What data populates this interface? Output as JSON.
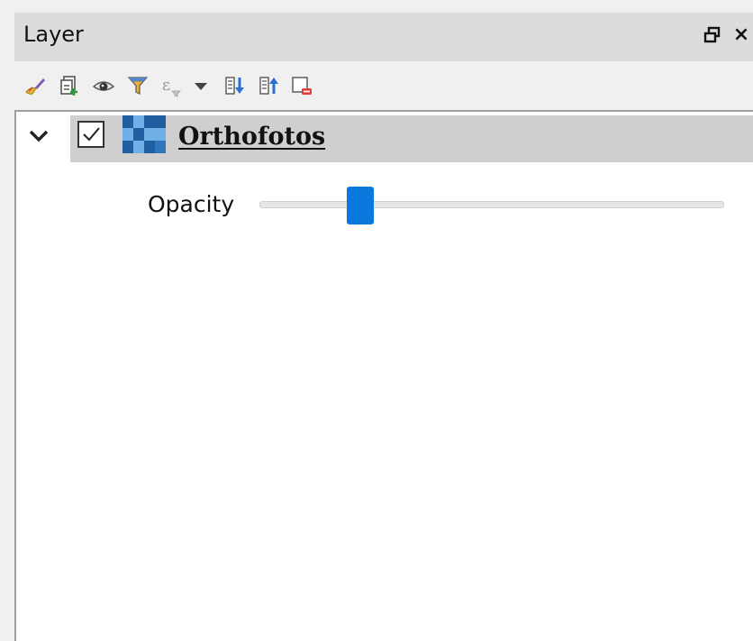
{
  "panel": {
    "title": "Layer",
    "close_glyph": "×"
  },
  "toolbar": {
    "tools": [
      {
        "name": "style-manager-icon"
      },
      {
        "name": "add-group-icon"
      },
      {
        "name": "visibility-eye-icon"
      },
      {
        "name": "filter-legend-icon"
      },
      {
        "name": "filter-expression-icon"
      },
      {
        "name": "dropdown-arrow-icon"
      },
      {
        "name": "expand-all-icon"
      },
      {
        "name": "collapse-all-icon"
      },
      {
        "name": "remove-layer-icon"
      }
    ]
  },
  "tree": {
    "layer": {
      "name": "Orthofotos",
      "checked": true,
      "expanded": true
    },
    "opacity": {
      "label": "Opacity",
      "value": 0.2
    }
  },
  "colors": {
    "accent": "#0a78dd",
    "row_selected": "#cfcfcf",
    "titlebar": "#dcdcdc"
  }
}
